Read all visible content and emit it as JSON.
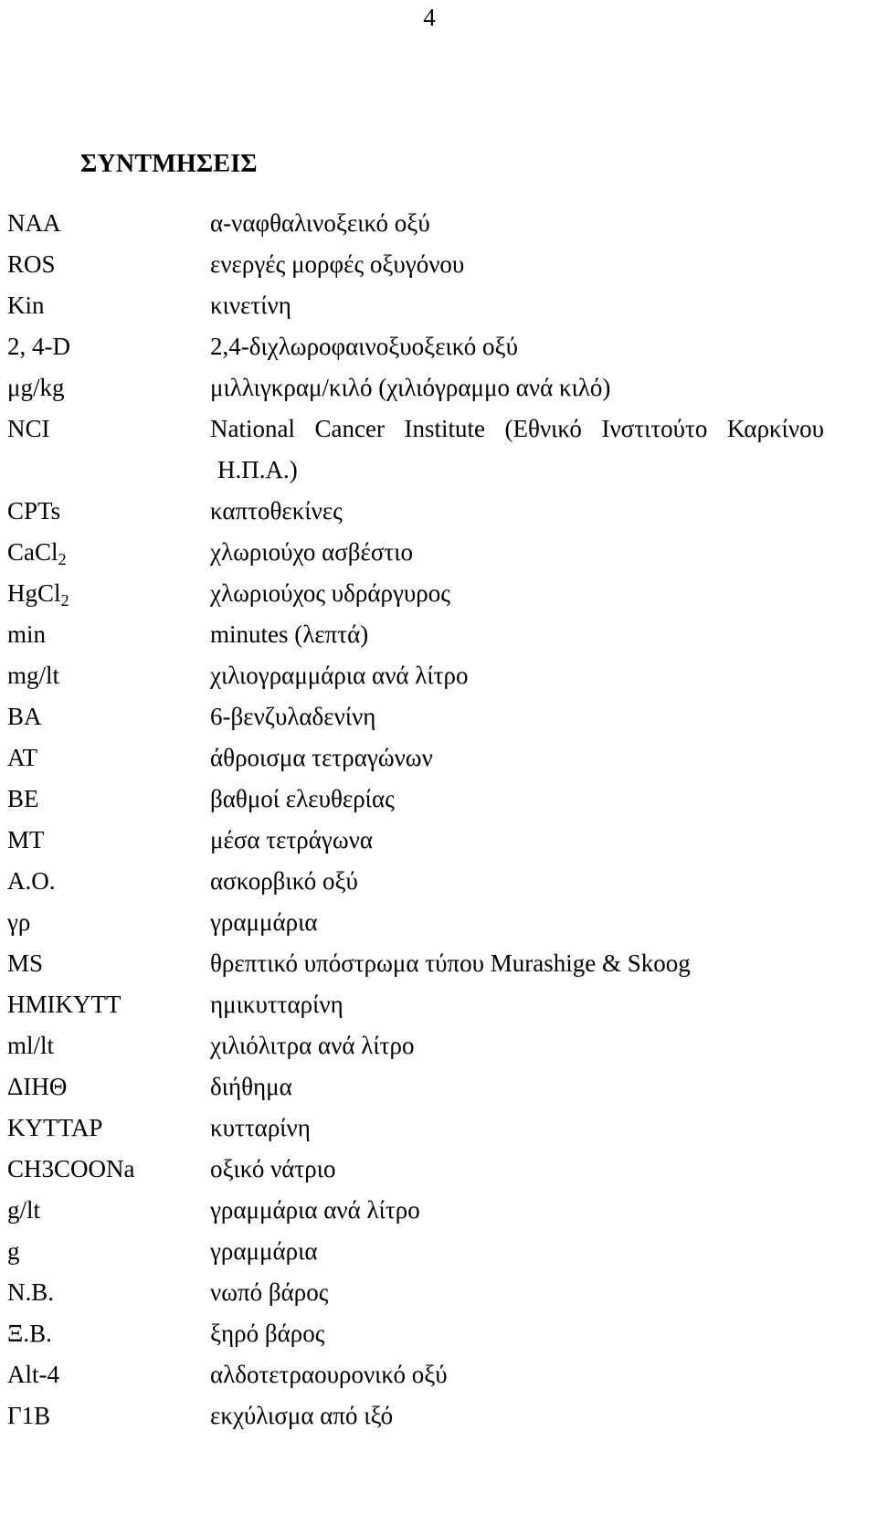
{
  "page": {
    "number": "4"
  },
  "heading": {
    "title": "ΣΥΝΤΜΗΣΕΙΣ"
  },
  "abbreviations": [
    {
      "term": "NAA",
      "definition": "α-ναφθαλινοξεικό οξύ"
    },
    {
      "term": "ROS",
      "definition": "ενεργές μορφές οξυγόνου"
    },
    {
      "term": "Kin",
      "definition": "κινετίνη"
    },
    {
      "term": "2, 4-D",
      "definition": "2,4-διχλωροφαινοξυοξεικό οξύ"
    },
    {
      "term": "μg/kg",
      "definition": "μιλλιγκραμ/κιλό  (χιλιόγραμμο ανά κιλό)"
    },
    {
      "term": "NCI",
      "definition": "National Cancer Institute (Εθνικό Ινστιτούτο Καρκίνου",
      "definition_continued": "Η.Π.Α.)",
      "justified": true
    },
    {
      "term": "CPTs",
      "definition": "καπτοθεκίνες"
    },
    {
      "term": "CaCl",
      "term_sub": "2",
      "definition": "χλωριούχο ασβέστιο"
    },
    {
      "term": "HgCl",
      "term_sub": "2",
      "definition": "χλωριούχος υδράργυρος"
    },
    {
      "term": "min",
      "definition": "minutes (λεπτά)"
    },
    {
      "term": "mg/lt",
      "definition": "χιλιογραμμάρια ανά λίτρο"
    },
    {
      "term": "BA",
      "definition": "6-βενζυλαδενίνη"
    },
    {
      "term": "AT",
      "definition": "άθροισμα τετραγώνων"
    },
    {
      "term": "BE",
      "definition": "βαθμοί ελευθερίας"
    },
    {
      "term": "MT",
      "definition": "μέσα τετράγωνα"
    },
    {
      "term": "A.O.",
      "definition": "ασκορβικό οξύ"
    },
    {
      "term": "γρ",
      "definition": "γραμμάρια"
    },
    {
      "term": "MS",
      "definition": "θρεπτικό υπόστρωμα τύπου Murashige & Skoog"
    },
    {
      "term": "ΗΜΙΚΥΤΤ",
      "definition": "ημικυτταρίνη"
    },
    {
      "term": "ml/lt",
      "definition": "χιλιόλιτρα ανά λίτρο"
    },
    {
      "term": "ΔΙΗΘ",
      "definition": "διήθημα"
    },
    {
      "term": "ΚΥΤΤΑΡ",
      "definition": "κυτταρίνη"
    },
    {
      "term": "CH3COONa",
      "definition": "οξικό νάτριο"
    },
    {
      "term": "g/lt",
      "definition": "γραμμάρια ανά λίτρο"
    },
    {
      "term": "g",
      "definition": "γραμμάρια"
    },
    {
      "term": "N.B.",
      "definition": "νωπό βάρος"
    },
    {
      "term": "Ξ.Β.",
      "definition": "ξηρό βάρος"
    },
    {
      "term": "Alt-4",
      "definition": "αλδοτετραουρονικό οξύ"
    },
    {
      "term": "Γ1Β",
      "definition": "εκχύλισμα από ιξό"
    }
  ]
}
